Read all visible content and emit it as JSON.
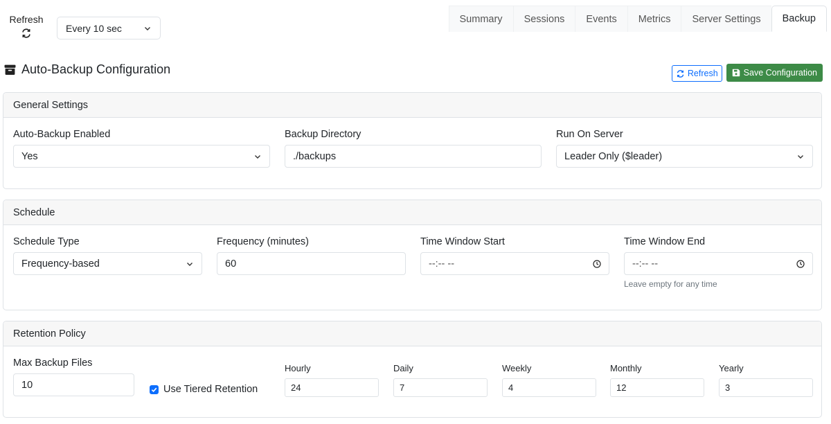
{
  "toolbar": {
    "refresh_label": "Refresh",
    "interval_value": "Every 10 sec"
  },
  "tabs": [
    {
      "label": "Summary"
    },
    {
      "label": "Sessions"
    },
    {
      "label": "Events"
    },
    {
      "label": "Metrics"
    },
    {
      "label": "Server Settings"
    },
    {
      "label": "Backup",
      "active": true
    }
  ],
  "page": {
    "title": "Auto-Backup Configuration",
    "refresh_button": "Refresh",
    "save_button": "Save Configuration"
  },
  "general": {
    "header": "General Settings",
    "enabled_label": "Auto-Backup Enabled",
    "enabled_value": "Yes",
    "directory_label": "Backup Directory",
    "directory_value": "./backups",
    "server_label": "Run On Server",
    "server_value": "Leader Only ($leader)"
  },
  "schedule": {
    "header": "Schedule",
    "type_label": "Schedule Type",
    "type_value": "Frequency-based",
    "frequency_label": "Frequency (minutes)",
    "frequency_value": "60",
    "start_label": "Time Window Start",
    "start_value": "--:-- --",
    "end_label": "Time Window End",
    "end_value": "--:-- --",
    "end_help": "Leave empty for any time"
  },
  "retention": {
    "header": "Retention Policy",
    "max_label": "Max Backup Files",
    "max_value": "10",
    "tiered_label": "Use Tiered Retention",
    "tiered_checked": true,
    "hourly_label": "Hourly",
    "hourly_value": "24",
    "daily_label": "Daily",
    "daily_value": "7",
    "weekly_label": "Weekly",
    "weekly_value": "4",
    "monthly_label": "Monthly",
    "monthly_value": "12",
    "yearly_label": "Yearly",
    "yearly_value": "3"
  },
  "colors": {
    "primary": "#0d6efd",
    "success": "#3d8b47",
    "border": "#dee2e6"
  }
}
